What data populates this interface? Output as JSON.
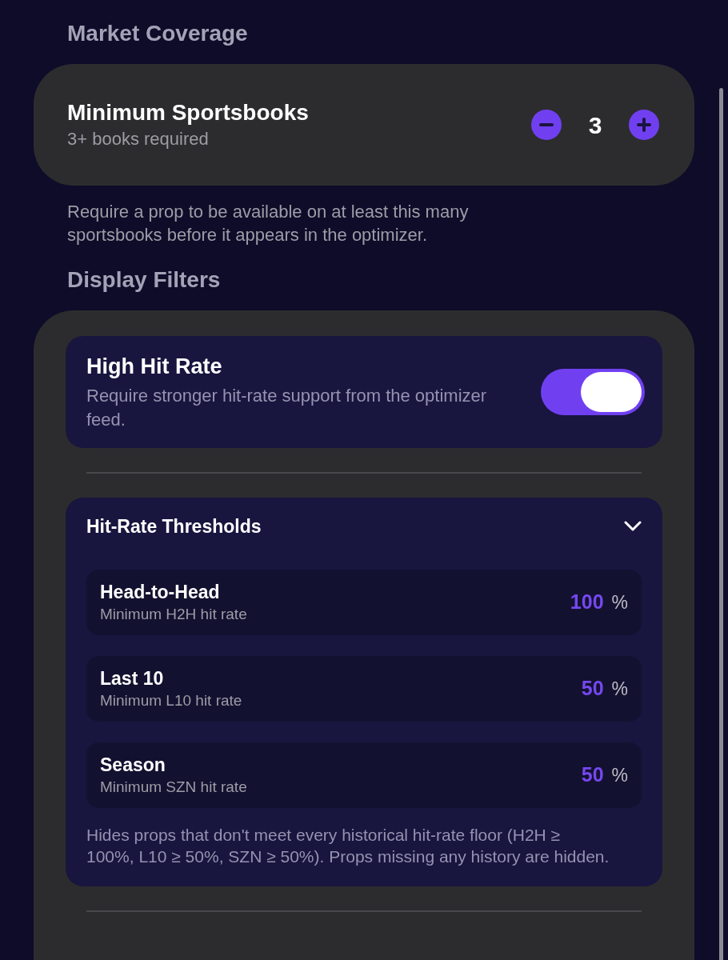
{
  "market_coverage": {
    "heading": "Market Coverage",
    "title": "Minimum Sportsbooks",
    "subtitle": "3+ books required",
    "value": "3",
    "description": "Require a prop to be available on at least this many sportsbooks before it appears in the optimizer."
  },
  "display_filters": {
    "heading": "Display Filters",
    "high_hit_rate": {
      "title": "High Hit Rate",
      "description": "Require stronger hit-rate support from the optimizer feed.",
      "on": true
    },
    "thresholds": {
      "title": "Hit-Rate Thresholds",
      "expanded": true,
      "rows": [
        {
          "title": "Head-to-Head",
          "subtitle": "Minimum H2H hit rate",
          "value": "100",
          "unit": "%"
        },
        {
          "title": "Last 10",
          "subtitle": "Minimum L10 hit rate",
          "value": "50",
          "unit": "%"
        },
        {
          "title": "Season",
          "subtitle": "Minimum SZN hit rate",
          "value": "50",
          "unit": "%"
        }
      ],
      "note": "Hides props that don't meet every historical hit-rate floor (H2H ≥ 100%, L10 ≥ 50%, SZN ≥ 50%). Props missing any history are hidden."
    }
  }
}
